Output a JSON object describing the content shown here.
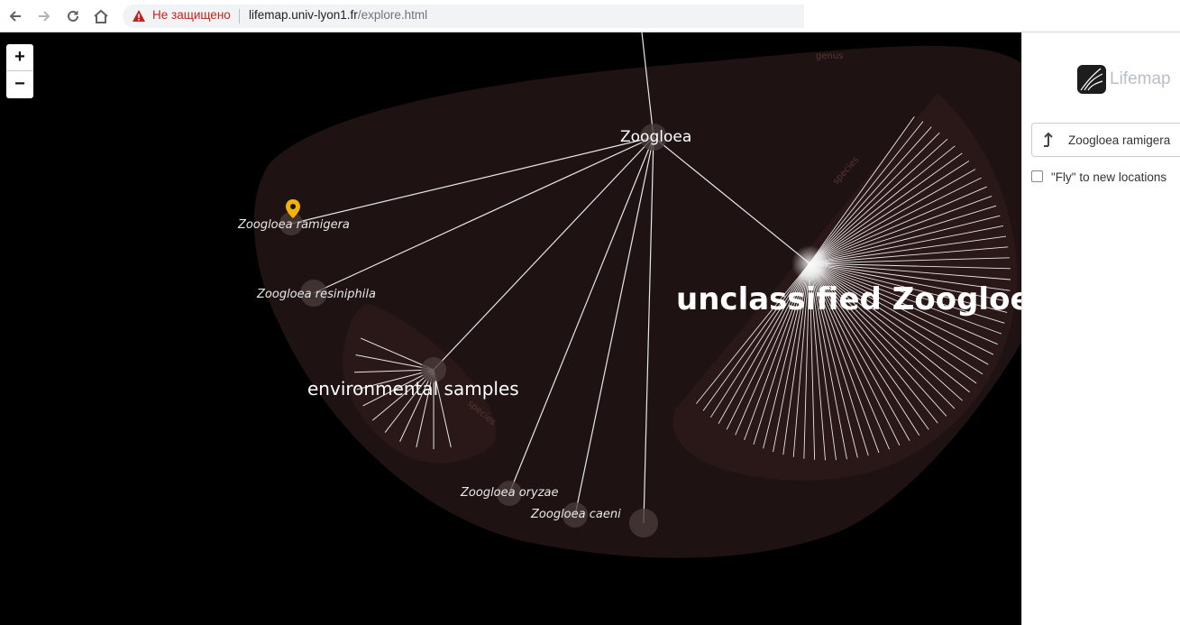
{
  "browser": {
    "back_icon": "arrow-left-icon",
    "forward_icon": "arrow-right-icon",
    "reload_icon": "reload-icon",
    "home_icon": "home-icon",
    "warning_icon": "warning-triangle-icon",
    "security_text": "Не защищено",
    "url_host": "lifemap.univ-lyon1.fr",
    "url_path": "/explore.html"
  },
  "map": {
    "zoom_in": "+",
    "zoom_out": "−",
    "zone_labels": {
      "genus": "genus",
      "species_right": "species",
      "species_left": "species"
    },
    "taxa": {
      "genus": "Zoogloea",
      "ramigera": "Zoogloea ramigera",
      "resiniphila": "Zoogloea resiniphila",
      "environmental": "environmental samples",
      "unclassified": "unclassified Zoogloea",
      "oryzae": "Zoogloea oryzae",
      "caeni": "Zoogloea caeni"
    },
    "marker_icon": "map-pin-icon",
    "colors": {
      "marker": "#f2b400",
      "zone": "#1f1212",
      "branch": "#e8e8e8"
    }
  },
  "sidebar": {
    "logo_text": "Lifemap",
    "search_icon": "arrow-up-icon",
    "search_value": "Zoogloea ramigera",
    "fly_label": "\"Fly\" to new locations",
    "fly_checked": false
  }
}
